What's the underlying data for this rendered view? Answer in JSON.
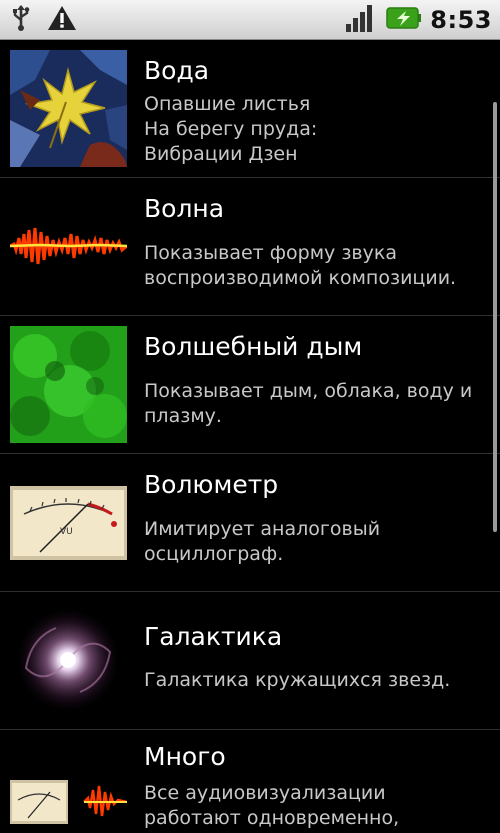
{
  "status_bar": {
    "time": "8:53",
    "icons": [
      "usb-icon",
      "warning-icon",
      "signal-icon",
      "battery-charging-icon"
    ],
    "colors": {
      "battery": "#3aa21a",
      "bar_bg": "#e3e3e3"
    }
  },
  "items": [
    {
      "title": "Вода",
      "desc": [
        "Опавшие листья",
        "На берегу пруда:",
        "Вибрации Дзен"
      ],
      "icon": "leaves-thumbnail"
    },
    {
      "title": "Волна",
      "desc": [
        "Показывает форму звука",
        "воспроизводимой композиции."
      ],
      "icon": "waveform-thumbnail"
    },
    {
      "title": "Волшебный дым",
      "desc": [
        "Показывает дым, облака, воду и",
        "плазму."
      ],
      "icon": "green-smoke-thumbnail"
    },
    {
      "title": "Волюметр",
      "desc": [
        "Имитирует аналоговый",
        "осциллограф."
      ],
      "icon": "vu-meter-thumbnail"
    },
    {
      "title": "Галактика",
      "desc": [
        "Галактика кружащихся звезд."
      ],
      "icon": "galaxy-thumbnail"
    },
    {
      "title": "Много",
      "desc": [
        "Все аудиовизуализации",
        "работают одновременно,"
      ],
      "icon": "multiple-visualizers-thumbnail"
    }
  ]
}
